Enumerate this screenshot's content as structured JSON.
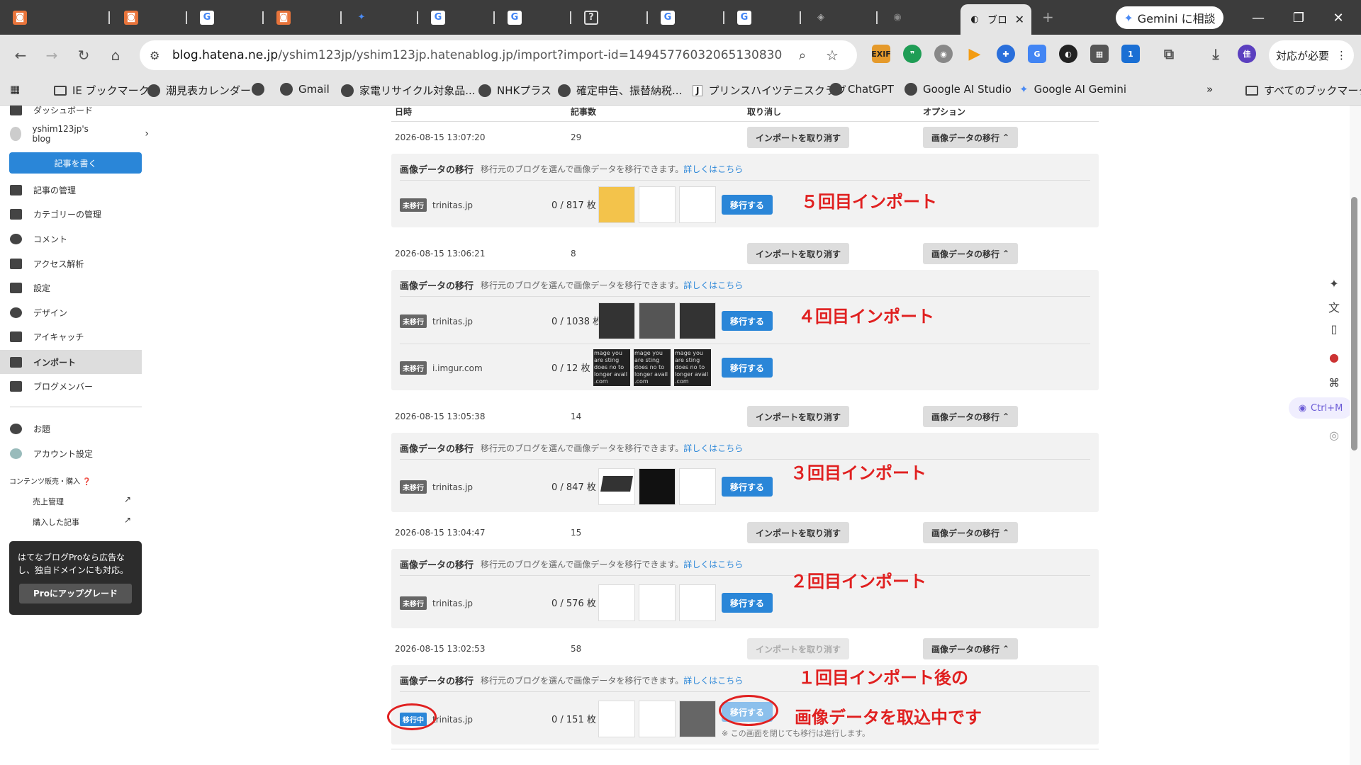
{
  "browser": {
    "tabs": [
      {
        "icon": "hatena-icon"
      },
      {
        "icon": "hatena-icon"
      },
      {
        "icon": "google-icon"
      },
      {
        "icon": "hatena-icon"
      },
      {
        "icon": "gemini-icon"
      },
      {
        "icon": "google-icon"
      },
      {
        "icon": "google-icon"
      },
      {
        "icon": "help-icon"
      },
      {
        "icon": "google-icon"
      },
      {
        "icon": "google-icon"
      },
      {
        "icon": "misc-icon"
      },
      {
        "icon": "chrome-icon"
      }
    ],
    "active_tab_label": "ブロ",
    "gemini_button": "Gemini に相談",
    "url_host": "blog.hatena.ne.jp",
    "url_path": "/yshim123jp/yshim123jp.hatenablog.jp/import?import-id=14945776032065130830",
    "action_button": "対応が必要",
    "bookmarks": [
      "IE ブックマーク",
      "潮見表カレンダー",
      "",
      "Gmail",
      "家電リサイクル対象品...",
      "NHKプラス",
      "確定申告、振替納税...",
      "プリンスハイツテニスクラブ",
      "ChatGPT",
      "Google AI Studio",
      "Google AI Gemini"
    ],
    "all_bookmarks": "すべてのブックマーク"
  },
  "sidebar": {
    "dashboard": "ダッシュボード",
    "blog_name": "yshim123jp's blog",
    "write_button": "記事を書く",
    "items": [
      "記事の管理",
      "カテゴリーの管理",
      "コメント",
      "アクセス解析",
      "設定",
      "デザイン",
      "アイキャッチ",
      "インポート",
      "ブログメンバー"
    ],
    "items2": [
      "お題",
      "アカウント設定"
    ],
    "contents_heading": "コンテンツ販売・購入",
    "sub_items": [
      "売上管理",
      "購入した記事"
    ],
    "pro_text": "はてなブログProなら広告なし、独自ドメインにも対応。",
    "pro_button": "Proにアップグレード"
  },
  "table": {
    "headers": {
      "date": "日時",
      "count": "記事数",
      "cancel": "取り消し",
      "option": "オプション"
    },
    "cancel_label": "インポートを取り消す",
    "option_label": "画像データの移行",
    "panel_title": "画像データの移行",
    "panel_desc": "移行元のブログを選んで画像データを移行できます。",
    "panel_link": "詳しくはこちら",
    "move_label": "移行する",
    "badge_pending": "未移行",
    "badge_running": "移行中",
    "running_note": "※ この画面を閉じても移行は進行します。",
    "rows": [
      {
        "date": "2026-08-15 13:07:20",
        "count": "29",
        "sources": [
          {
            "name": "trinitas.jp",
            "count": "0 / 817 枚"
          }
        ],
        "annotation": "５回目インポート"
      },
      {
        "date": "2026-08-15 13:06:21",
        "count": "8",
        "sources": [
          {
            "name": "trinitas.jp",
            "count": "0 / 1038 枚"
          },
          {
            "name": "i.imgur.com",
            "count": "0 / 12 枚"
          }
        ],
        "annotation": "４回目インポート"
      },
      {
        "date": "2026-08-15 13:05:38",
        "count": "14",
        "sources": [
          {
            "name": "trinitas.jp",
            "count": "0 / 847 枚"
          }
        ],
        "annotation": "３回目インポート"
      },
      {
        "date": "2026-08-15 13:04:47",
        "count": "15",
        "sources": [
          {
            "name": "trinitas.jp",
            "count": "0 / 576 枚"
          }
        ],
        "annotation": "２回目インポート"
      },
      {
        "date": "2026-08-15 13:02:53",
        "count": "58",
        "sources": [
          {
            "name": "trinitas.jp",
            "count": "0 / 151 枚"
          }
        ],
        "annotation": "１回目インポート後の",
        "annotation2": "画像データを取込中です"
      }
    ],
    "imgur_thumb_text": "mage you are sting does no to longer avail .com"
  },
  "right_tools": {
    "ctrl_label": "Ctrl+M"
  },
  "colors": {
    "accent": "#2a86d8",
    "annotation": "#e02020",
    "chrome_dark": "#3c3c3c",
    "chrome_light": "#e5e5e5"
  }
}
